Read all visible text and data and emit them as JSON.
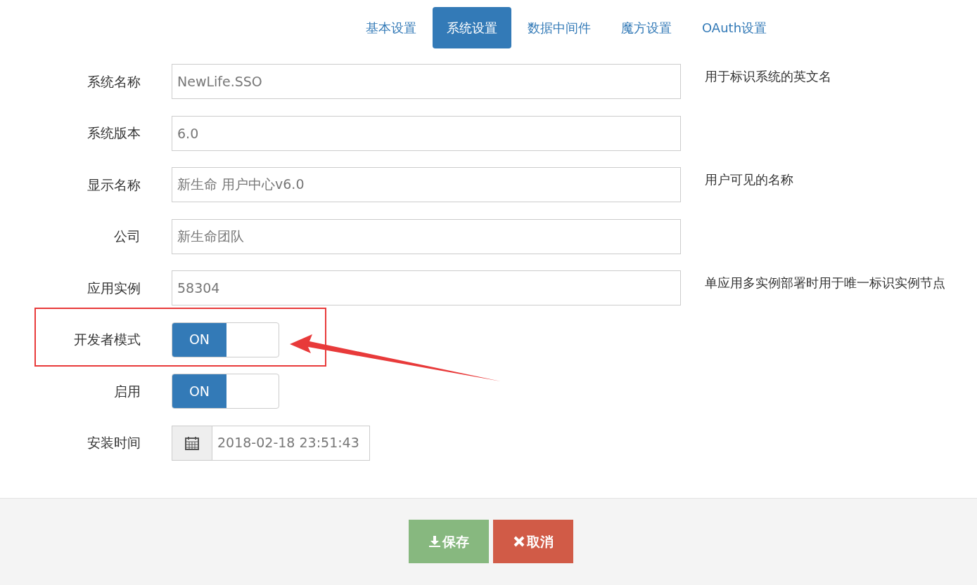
{
  "tabs": [
    {
      "label": "基本设置",
      "selected": false
    },
    {
      "label": "系统设置",
      "selected": true
    },
    {
      "label": "数据中间件",
      "selected": false
    },
    {
      "label": "魔方设置",
      "selected": false
    },
    {
      "label": "OAuth设置",
      "selected": false
    }
  ],
  "fields": [
    {
      "kind": "text",
      "label": "系统名称",
      "value": "NewLife.SSO",
      "help": "用于标识系统的英文名"
    },
    {
      "kind": "text",
      "label": "系统版本",
      "value": "6.0"
    },
    {
      "kind": "text",
      "label": "显示名称",
      "value": "新生命 用户中心v6.0",
      "help": "用户可见的名称"
    },
    {
      "kind": "text",
      "label": "公司",
      "value": "新生命团队"
    },
    {
      "kind": "text",
      "label": "应用实例",
      "value": "58304",
      "help": "单应用多实例部署时用于唯一标识实例节点"
    },
    {
      "kind": "toggle",
      "label": "开发者模式",
      "on": true,
      "text": "ON",
      "highlighted": true
    },
    {
      "kind": "toggle",
      "label": "启用",
      "on": true,
      "text": "ON",
      "highlighted": false
    },
    {
      "kind": "date",
      "label": "安装时间",
      "value": "2018-02-18 23:51:43"
    }
  ],
  "buttons": [
    {
      "kind": "save",
      "label": "保存"
    },
    {
      "kind": "cancel",
      "label": "取消"
    }
  ]
}
